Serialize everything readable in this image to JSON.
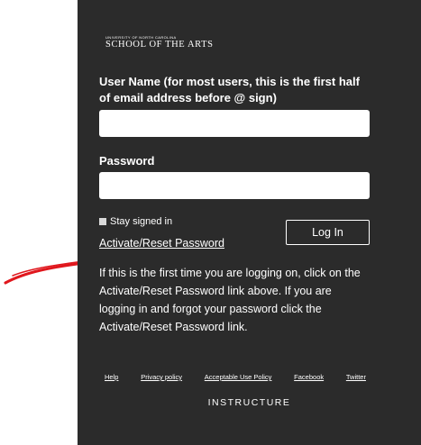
{
  "logo": {
    "small": "UNIVERSITY OF NORTH CAROLINA",
    "big": "SCHOOL OF THE ARTS"
  },
  "form": {
    "username_label": "User Name (for most users, this is the first half of email address before @ sign)",
    "username_value": "",
    "password_label": "Password",
    "password_value": "",
    "stay_signed_in": "Stay signed in",
    "login_button": "Log In",
    "reset_link": "Activate/Reset Password"
  },
  "help_text": "If this is the first time you are logging on, click on the Activate/Reset Password link above. If you are logging in and forgot your password click the Activate/Reset Password link.",
  "footer": {
    "links": [
      "Help",
      "Privacy policy",
      "Acceptable Use Policy",
      "Facebook",
      "Twitter"
    ],
    "brand": "INSTRUCTURE"
  },
  "colors": {
    "panel": "#2b2b2b",
    "text": "#ffffff",
    "arrow": "#e0171d"
  },
  "icons": {
    "annotation": "red-arrow-icon"
  }
}
